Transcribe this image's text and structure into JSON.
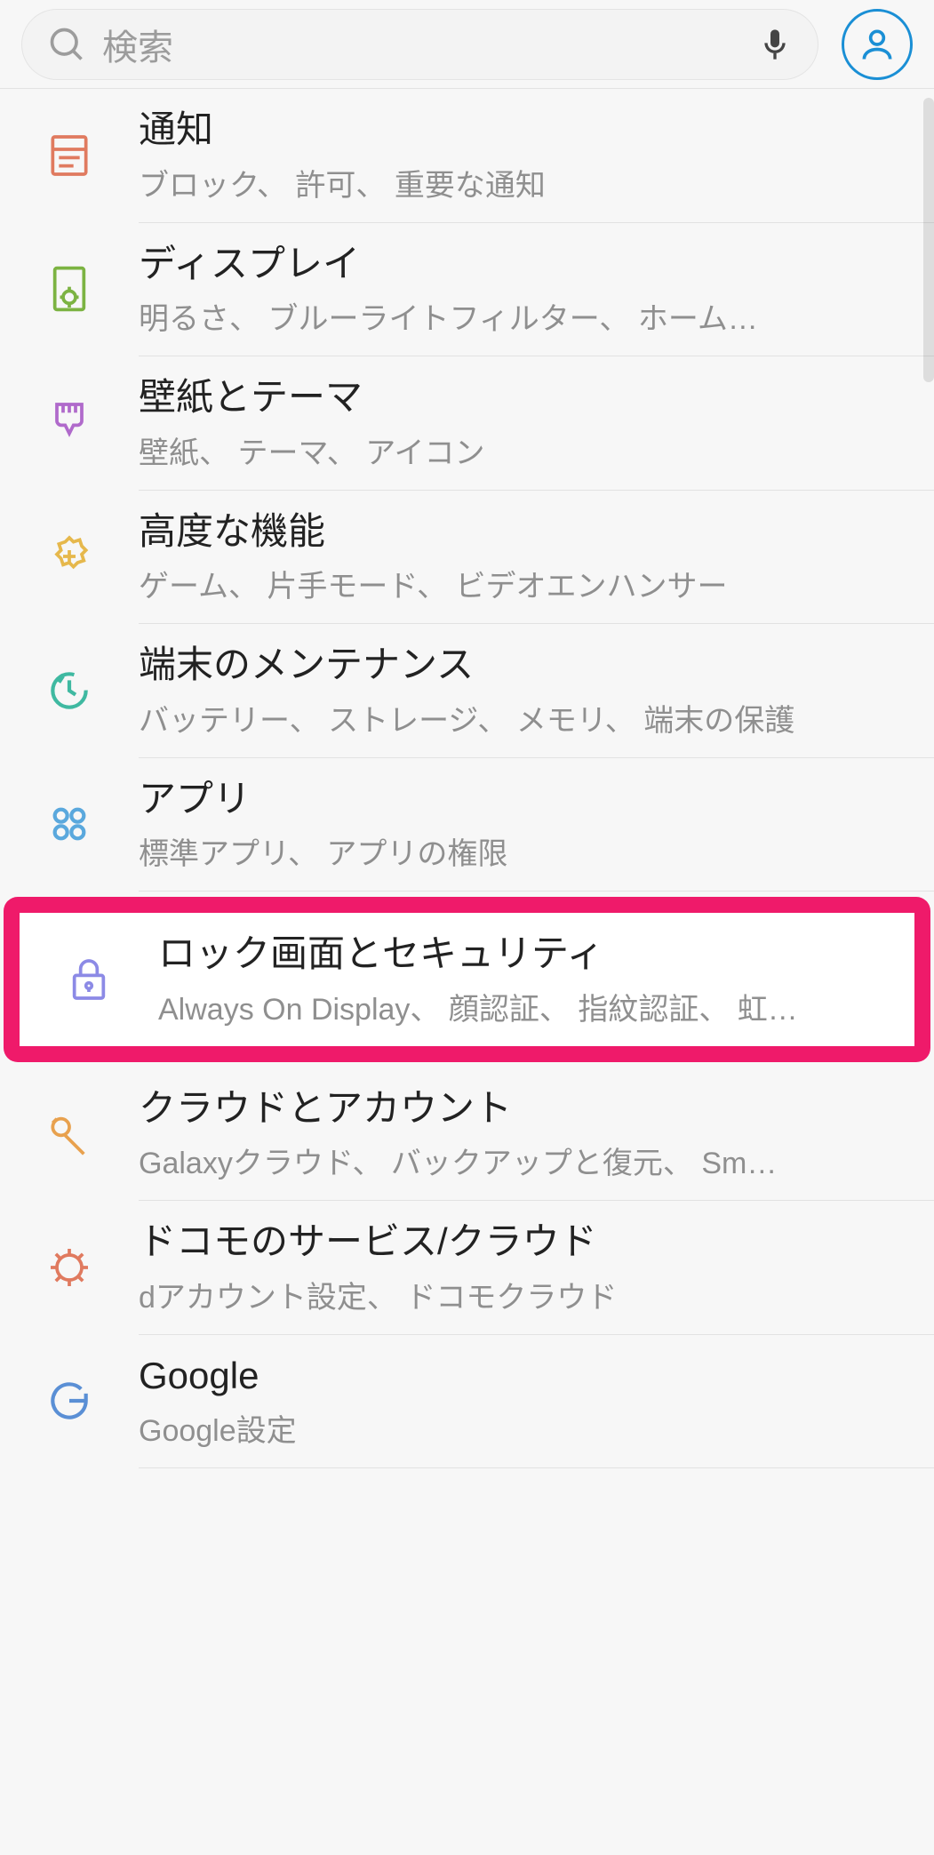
{
  "header": {
    "search_placeholder": "検索"
  },
  "items": [
    {
      "id": "notifications",
      "title": "通知",
      "sub": "ブロック、 許可、 重要な通知"
    },
    {
      "id": "display",
      "title": "ディスプレイ",
      "sub": "明るさ、 ブルーライトフィルター、 ホーム…"
    },
    {
      "id": "wallpaper",
      "title": "壁紙とテーマ",
      "sub": "壁紙、 テーマ、 アイコン"
    },
    {
      "id": "advanced",
      "title": "高度な機能",
      "sub": "ゲーム、 片手モード、 ビデオエンハンサー"
    },
    {
      "id": "maintenance",
      "title": "端末のメンテナンス",
      "sub": "バッテリー、 ストレージ、 メモリ、 端末の保護"
    },
    {
      "id": "apps",
      "title": "アプリ",
      "sub": "標準アプリ、 アプリの権限"
    },
    {
      "id": "lockscreen",
      "title": "ロック画面とセキュリティ",
      "sub": "Always On Display、 顔認証、 指紋認証、 虹…"
    },
    {
      "id": "cloud",
      "title": "クラウドとアカウント",
      "sub": "Galaxyクラウド、 バックアップと復元、 Sm…"
    },
    {
      "id": "docomo",
      "title": "ドコモのサービス/クラウド",
      "sub": "dアカウント設定、 ドコモクラウド"
    },
    {
      "id": "google",
      "title": "Google",
      "sub": "Google設定"
    }
  ]
}
